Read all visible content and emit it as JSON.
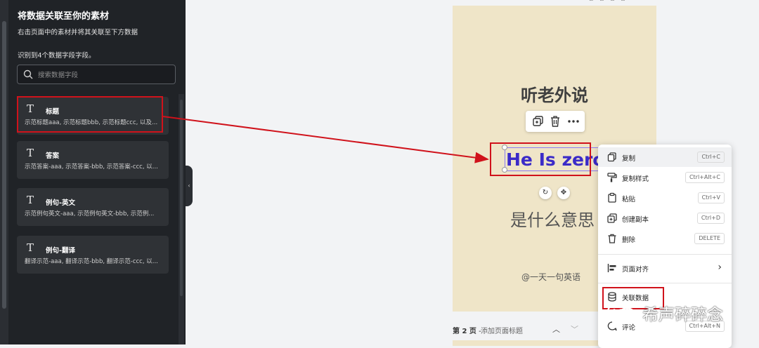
{
  "panel": {
    "title": "将数据关联至你的素材",
    "subtitle": "右击页面中的素材并将其关联至下方数据",
    "found_text": "识别到4个数据字段字段。",
    "search_placeholder": "搜索数据字段",
    "fields": [
      {
        "name": "标题",
        "examples": "示范标题aaa, 示范标题bbb, 示范标题ccc, 以及..."
      },
      {
        "name": "答案",
        "examples": "示范答案-aaa, 示范答案-bbb, 示范答案-ccc, 以..."
      },
      {
        "name": "例句-英文",
        "examples": "示范例句英文-aaa, 示范例句英文-bbb, 示范例..."
      },
      {
        "name": "例句-翻译",
        "examples": "翻译示范-aaa, 翻译示范-bbb, 翻译示范-ccc, 以..."
      }
    ]
  },
  "canvas": {
    "heading": "听老外说",
    "selected_text": "He Is zero",
    "subheading": "是什么意思",
    "footer": "@一天一句英语",
    "background": "#efe5c8"
  },
  "page_bar": {
    "page_label": "第 2 页",
    "separator": " - ",
    "add_title": "添加页面标题"
  },
  "context_menu": {
    "items": [
      {
        "label": "复制",
        "shortcut": "Ctrl+C",
        "icon": "copy-icon"
      },
      {
        "label": "复制样式",
        "shortcut": "Ctrl+Alt+C",
        "icon": "paint-roller-icon"
      },
      {
        "label": "粘贴",
        "shortcut": "Ctrl+V",
        "icon": "clipboard-icon"
      },
      {
        "label": "创建副本",
        "shortcut": "Ctrl+D",
        "icon": "duplicate-icon"
      },
      {
        "label": "删除",
        "shortcut": "DELETE",
        "icon": "trash-icon"
      },
      {
        "label": "页面对齐",
        "icon": "align-icon"
      },
      {
        "label": "关联数据",
        "icon": "database-icon"
      },
      {
        "label": "评论",
        "shortcut": "Ctrl+Alt+N",
        "icon": "comment-icon"
      }
    ]
  },
  "watermark": {
    "text": "希声碎碎念"
  },
  "colors": {
    "panel_bg": "#202327",
    "field_bg": "#2f3236",
    "annotation_red": "#d0121b",
    "selected_text": "#3b2bc8"
  }
}
